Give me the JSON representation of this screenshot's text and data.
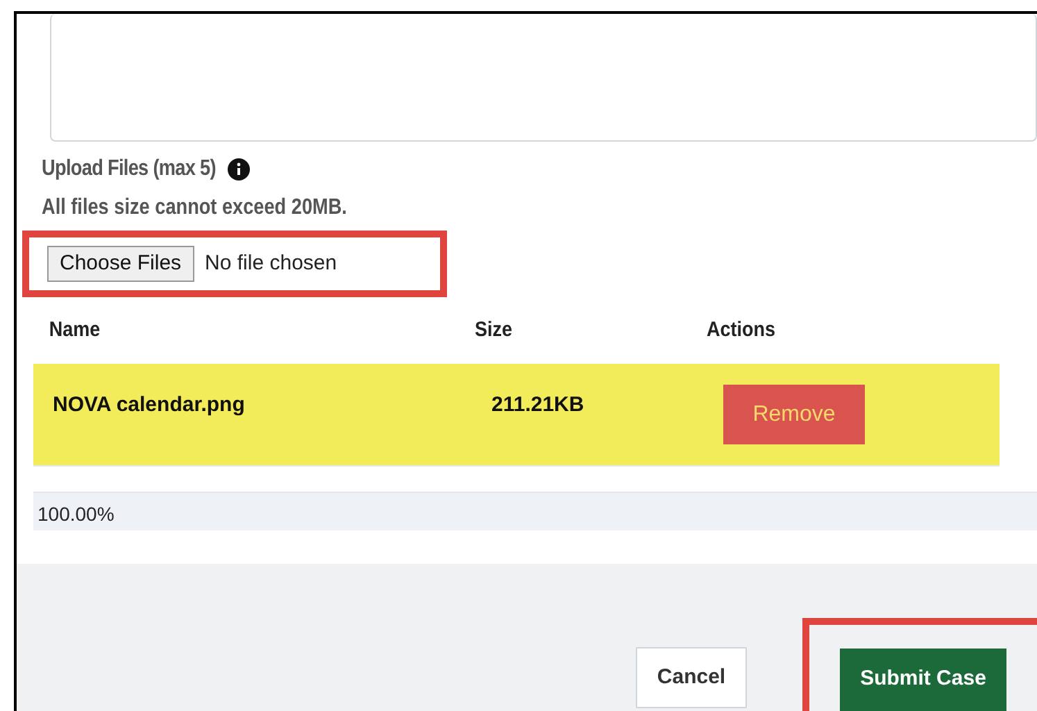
{
  "upload": {
    "label": "Upload Files (max 5)",
    "note": "All files size cannot exceed 20MB.",
    "file_input": {
      "button": "Choose Files",
      "value": "No file chosen",
      "annotated": true
    }
  },
  "table": {
    "columns": [
      "Name",
      "Size",
      "Actions"
    ],
    "rows": [
      {
        "name": "NOVA calendar.png",
        "size": "211.21KB",
        "action": "Remove",
        "highlighted": true
      }
    ]
  },
  "progress": {
    "level": 1,
    "reading": "100.00%"
  },
  "buttons": [
    {
      "label": "Cancel",
      "kind": "secondary",
      "annotated": false
    },
    {
      "label": "Submit Case",
      "kind": "primary",
      "annotated": true
    }
  ]
}
